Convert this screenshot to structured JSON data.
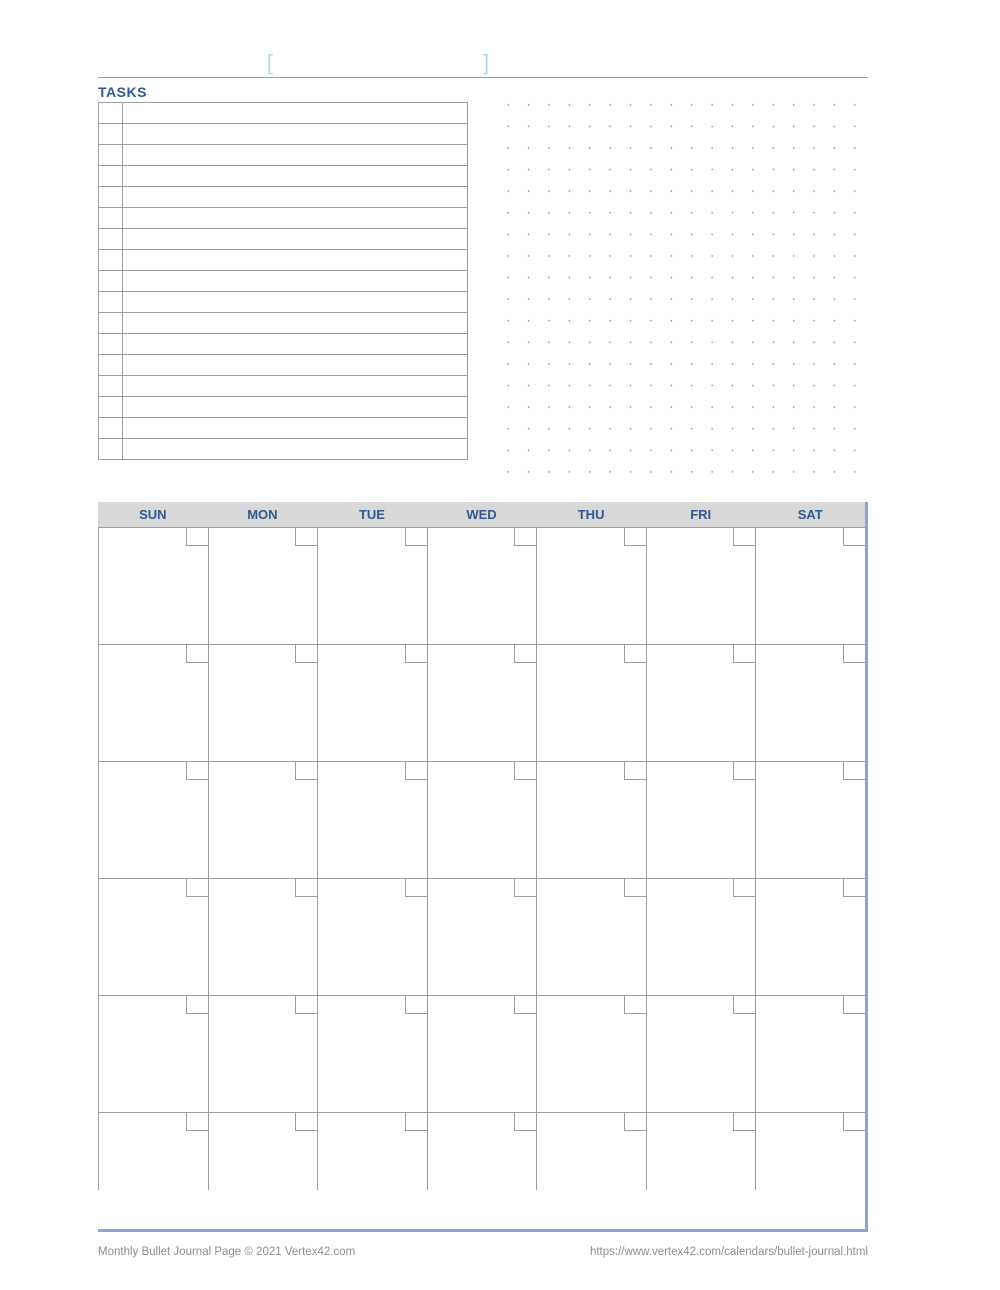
{
  "title_bracket_left": "[",
  "title_bracket_right": "]",
  "tasks": {
    "heading": "TASKS",
    "row_count": 17
  },
  "dot_grid": {
    "cols": 19,
    "rows": 18
  },
  "calendar": {
    "days": [
      "SUN",
      "MON",
      "TUE",
      "WED",
      "THU",
      "FRI",
      "SAT"
    ],
    "weeks": 6
  },
  "footer": {
    "left": "Monthly Bullet Journal Page © 2021 Vertex42.com",
    "right": "https://www.vertex42.com/calendars/bullet-journal.html"
  }
}
